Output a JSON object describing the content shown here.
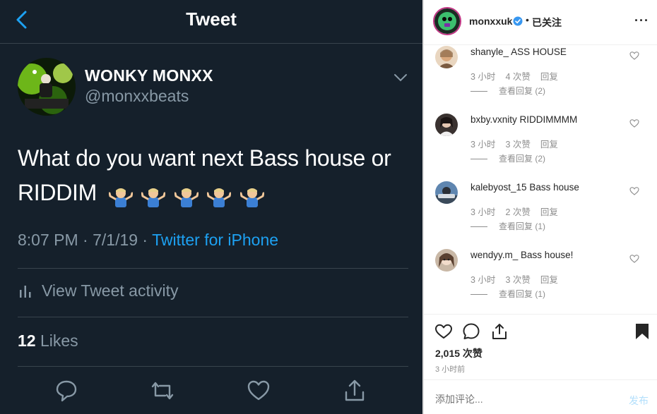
{
  "twitter": {
    "header": {
      "title": "Tweet"
    },
    "author": {
      "name": "WONKY MONXX",
      "handle": "@monxxbeats"
    },
    "tweet": {
      "text_line1": "What do you want next Bass house or",
      "text_line2": "RIDDIM",
      "emoji_count": 5
    },
    "meta": {
      "time": "8:07 PM · 7/1/19 · ",
      "source": "Twitter for iPhone"
    },
    "activity_label": "View Tweet activity",
    "likes": {
      "count": "12",
      "label": "Likes"
    },
    "colors": {
      "background": "#15202b",
      "accent": "#1da1f2",
      "muted": "#8899a6",
      "border": "#38444d"
    }
  },
  "instagram": {
    "header": {
      "username": "monxxuk",
      "separator": "•",
      "follow_label": "已关注",
      "more_label": "···"
    },
    "comments": [
      {
        "user": "shanyle_",
        "text": "ASS HOUSE",
        "time": "3 小时",
        "likes": "4 次赞",
        "reply": "回复",
        "view_replies": "查看回复 (2)"
      },
      {
        "user": "bxby.vxnity",
        "text": "RIDDIMMMM",
        "time": "3 小时",
        "likes": "3 次赞",
        "reply": "回复",
        "view_replies": "查看回复 (2)"
      },
      {
        "user": "kalebyost_15",
        "text": "Bass house",
        "time": "3 小时",
        "likes": "2 次赞",
        "reply": "回复",
        "view_replies": "查看回复 (1)"
      },
      {
        "user": "wendyy.m_",
        "text": "Bass house!",
        "time": "3 小时",
        "likes": "3 次赞",
        "reply": "回复",
        "view_replies": "查看回复 (1)"
      }
    ],
    "like_count": "2,015 次赞",
    "posted_ago": "3 小时前",
    "comment_input": {
      "placeholder": "添加评论..."
    },
    "post_label": "发布",
    "colors": {
      "text": "#262626",
      "muted": "#8e8e8e",
      "verified": "#3897f0",
      "post_disabled": "#b2dffc"
    }
  }
}
